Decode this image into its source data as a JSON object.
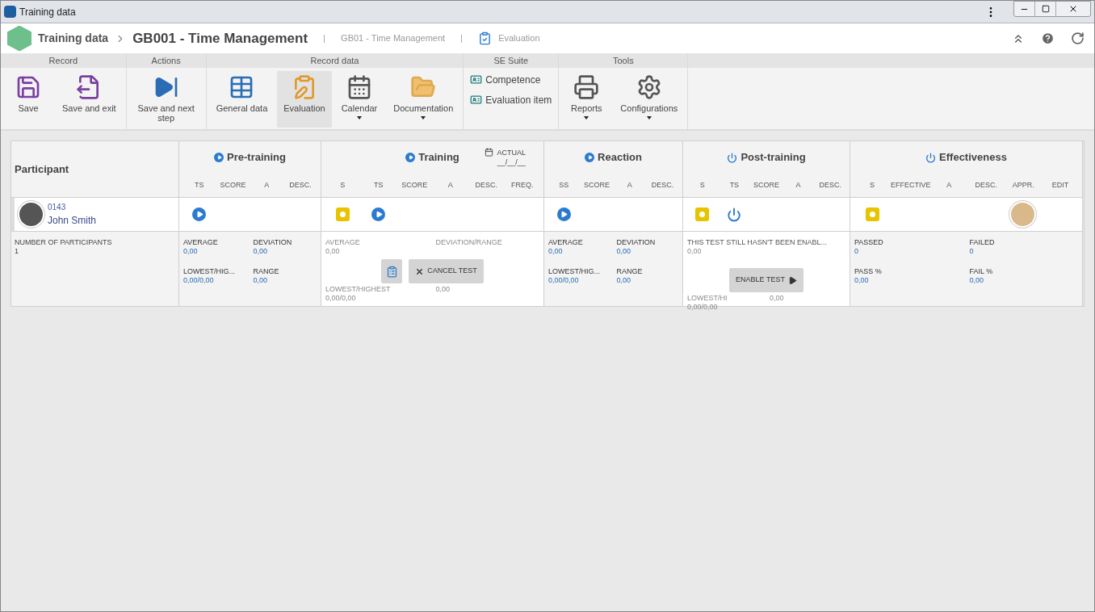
{
  "window": {
    "title": "Training data"
  },
  "breadcrumb": {
    "module": "Training data",
    "record": "GB001 - Time Management",
    "code": "GB01 - Time Management",
    "step": "Evaluation"
  },
  "toolbar": [
    {
      "group": "Record",
      "items": [
        {
          "label": "Save",
          "kind": "large",
          "selected": false,
          "dropdown": false
        },
        {
          "label": "Save and exit",
          "kind": "large",
          "selected": false,
          "dropdown": false
        }
      ]
    },
    {
      "group": "Actions",
      "items": [
        {
          "label": "Save and next step",
          "kind": "large",
          "selected": false,
          "dropdown": false
        }
      ]
    },
    {
      "group": "Record data",
      "items": [
        {
          "label": "General data",
          "kind": "large",
          "selected": false,
          "dropdown": false
        },
        {
          "label": "Evaluation",
          "kind": "large",
          "selected": true,
          "dropdown": false
        },
        {
          "label": "Calendar",
          "kind": "large",
          "selected": false,
          "dropdown": true
        },
        {
          "label": "Documentation",
          "kind": "large",
          "selected": false,
          "dropdown": true
        }
      ]
    },
    {
      "group": "SE Suite",
      "items": [
        {
          "label": "Competence",
          "kind": "small",
          "selected": false,
          "dropdown": false
        },
        {
          "label": "Evaluation item",
          "kind": "small",
          "selected": false,
          "dropdown": false
        }
      ]
    },
    {
      "group": "Tools",
      "items": [
        {
          "label": "Reports",
          "kind": "large",
          "selected": false,
          "dropdown": true
        },
        {
          "label": "Configurations",
          "kind": "large",
          "selected": false,
          "dropdown": true
        }
      ]
    }
  ],
  "table": {
    "participant_heading": "Participant",
    "participant": {
      "code": "0143",
      "name": "John Smith"
    },
    "count": {
      "label": "NUMBER OF PARTICIPANTS",
      "value": "1"
    },
    "sections": [
      {
        "title": "Pre-training",
        "enabled": true,
        "disabled": false,
        "columns": [
          {
            "label": "TS",
            "kind": "start"
          },
          {
            "label": "SCORE"
          },
          {
            "label": "A"
          },
          {
            "label": "DESC."
          }
        ],
        "stat_rows": [
          {
            "left": {
              "label": "AVERAGE",
              "value": "0,00"
            },
            "right": {
              "label": "DEVIATION",
              "value": "0,00"
            }
          },
          {
            "left": {
              "label": "LOWEST/HIG...",
              "value": "0,00/0,00"
            },
            "right": {
              "label": "RANGE",
              "value": "0,00"
            }
          }
        ]
      },
      {
        "title": "Training",
        "enabled": true,
        "disabled": true,
        "date": {
          "label": "ACTUAL",
          "value": "__/__/__"
        },
        "columns": [
          {
            "label": "S",
            "kind": "status"
          },
          {
            "label": "TS",
            "kind": "start"
          },
          {
            "label": "SCORE"
          },
          {
            "label": "A"
          },
          {
            "label": "DESC."
          },
          {
            "label": "FREQ."
          }
        ],
        "stat_rows": [
          {
            "left": {
              "label": "AVERAGE",
              "value": "0,00"
            },
            "right": {
              "label": "DEVIATION/RANGE"
            }
          },
          {
            "left": {
              "label": "LOWEST/HIGHEST",
              "value": "0,00/0,00"
            },
            "right": {
              "value": "0,00"
            }
          }
        ],
        "actions": [
          {
            "kind": "icon"
          },
          {
            "kind": "text",
            "label": "CANCEL TEST"
          }
        ]
      },
      {
        "title": "Reaction",
        "enabled": true,
        "disabled": false,
        "columns": [
          {
            "label": "SS",
            "kind": "start"
          },
          {
            "label": "SCORE"
          },
          {
            "label": "A"
          },
          {
            "label": "DESC."
          }
        ],
        "stat_rows": [
          {
            "left": {
              "label": "AVERAGE",
              "value": "0,00"
            },
            "right": {
              "label": "DEVIATION",
              "value": "0,00"
            }
          },
          {
            "left": {
              "label": "LOWEST/HIG...",
              "value": "0,00/0,00"
            },
            "right": {
              "label": "RANGE",
              "value": "0,00"
            }
          }
        ]
      },
      {
        "title": "Post-training",
        "enabled": false,
        "disabled": true,
        "columns": [
          {
            "label": "S",
            "kind": "status"
          },
          {
            "label": "TS",
            "kind": "power"
          },
          {
            "label": "SCORE"
          },
          {
            "label": "A"
          },
          {
            "label": "DESC."
          }
        ],
        "message": "THIS TEST STILL HASN'T BEEN ENABL...",
        "stat_rows": [
          {
            "left": {
              "value": "0,00"
            }
          },
          {
            "left": {
              "label": "LOWEST/HI",
              "value": "0,00/0,00"
            },
            "right": {
              "value": "0,00"
            }
          }
        ],
        "actions": [
          {
            "kind": "enable",
            "label": "ENABLE TEST"
          }
        ]
      },
      {
        "title": "Effectiveness",
        "enabled": false,
        "disabled": false,
        "columns": [
          {
            "label": "S",
            "kind": "status"
          },
          {
            "label": "EFFECTIVE"
          },
          {
            "label": "A"
          },
          {
            "label": "DESC."
          },
          {
            "label": "APPR.",
            "kind": "avatar"
          },
          {
            "label": "EDIT"
          }
        ],
        "stat_rows": [
          {
            "left": {
              "label": "PASSED",
              "value": "0"
            },
            "right": {
              "label": "FAILED",
              "value": "0"
            }
          },
          {
            "left": {
              "label": "PASS %",
              "value": "0,00"
            },
            "right": {
              "label": "FAIL %",
              "value": "0,00"
            }
          }
        ]
      }
    ]
  }
}
